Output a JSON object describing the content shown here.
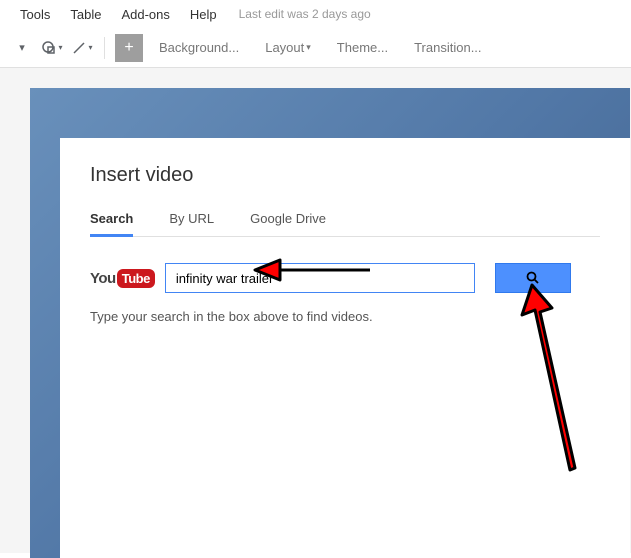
{
  "menubar": {
    "items": [
      "Tools",
      "Table",
      "Add-ons",
      "Help"
    ],
    "editInfo": "Last edit was 2 days ago"
  },
  "toolbar": {
    "background": "Background...",
    "layout": "Layout",
    "theme": "Theme...",
    "transition": "Transition..."
  },
  "dialog": {
    "title": "Insert video",
    "tabs": {
      "search": "Search",
      "byUrl": "By URL",
      "drive": "Google Drive"
    },
    "youtube": {
      "you": "You",
      "tube": "Tube"
    },
    "searchValue": "infinity war trailer",
    "helpText": "Type your search in the box above to find videos."
  }
}
